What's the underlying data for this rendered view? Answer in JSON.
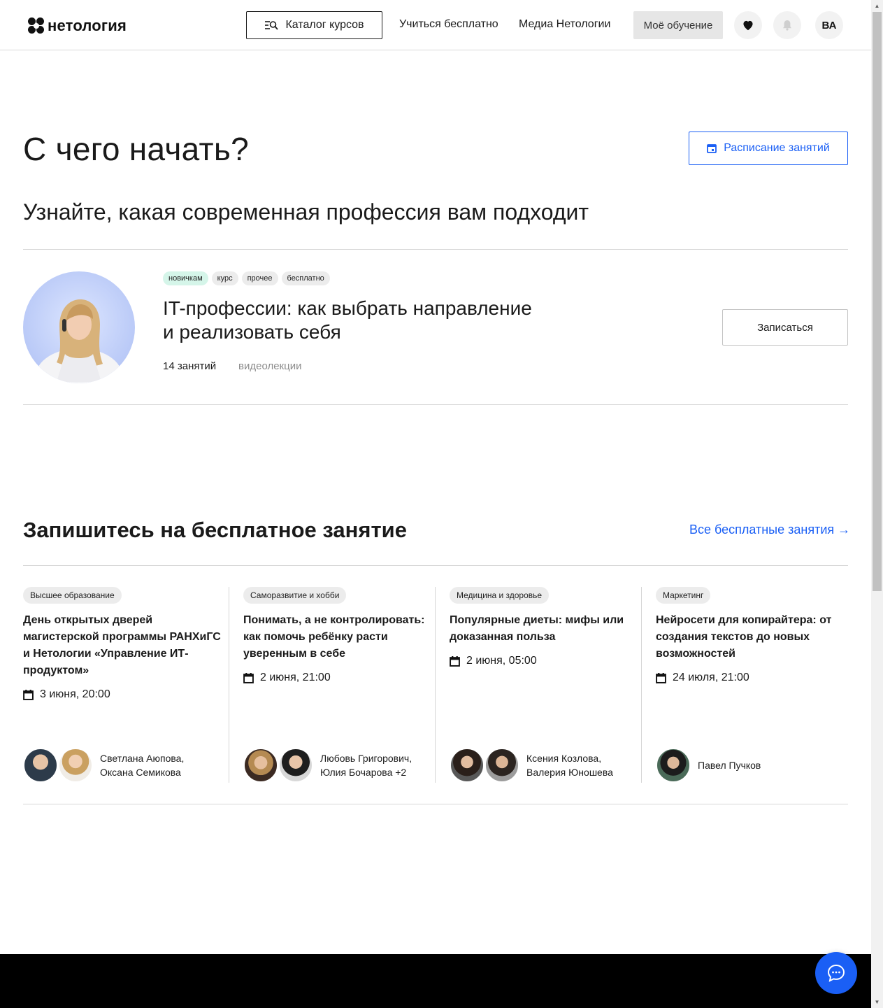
{
  "header": {
    "logo_text": "нетология",
    "catalog_label": "Каталог курсов",
    "nav": [
      "Учиться бесплатно",
      "Медиа Нетологии"
    ],
    "my_learning_label": "Моё обучение",
    "user_initials": "ВА"
  },
  "hero": {
    "title": "С чего начать?",
    "schedule_label": "Расписание занятий",
    "subtitle": "Узнайте, какая современная профессия вам подходит"
  },
  "course": {
    "tags": [
      "новичкам",
      "курс",
      "прочее",
      "бесплатно"
    ],
    "title_line1": "IT-профессии: как выбрать направление",
    "title_line2": "и реализовать себя",
    "lessons_count": "14 занятий",
    "format": "видеолекции",
    "enroll_label": "Записаться"
  },
  "free": {
    "title": "Запишитесь на бесплатное занятие",
    "all_link": "Все бесплатные занятия →",
    "lessons": [
      {
        "category": "Высшее образование",
        "title": "День открытых дверей магистерской программы РАНХиГС и Нетологии «Управление ИТ-продуктом»",
        "date": "3 июня, 20:00",
        "speakers_line1": "Светлана Аюпова,",
        "speakers_line2": "Оксана Семикова"
      },
      {
        "category": "Саморазвитие и хобби",
        "title": "Понимать, а не контролировать: как помочь ребёнку расти уверенным в себе",
        "date": "2 июня, 21:00",
        "speakers_line1": "Любовь Григорович,",
        "speakers_line2": "Юлия Бочарова +2"
      },
      {
        "category": "Медицина и здоровье",
        "title": "Популярные диеты: мифы или доказанная польза",
        "date": "2 июня, 05:00",
        "speakers_line1": "Ксения Козлова,",
        "speakers_line2": "Валерия Юношева"
      },
      {
        "category": "Маркетинг",
        "title": "Нейросети для копирайтера: от создания текстов до новых возможностей",
        "date": "24 июля, 21:00",
        "speakers_line1": "Павел Пучков",
        "speakers_line2": ""
      }
    ]
  },
  "colors": {
    "accent": "#1a5ff5",
    "tag_green": "#d5f5e9",
    "footer": "#000000"
  },
  "icons": [
    "catalog-search-icon",
    "heart-icon",
    "bell-icon",
    "calendar-icon",
    "chat-icon"
  ]
}
